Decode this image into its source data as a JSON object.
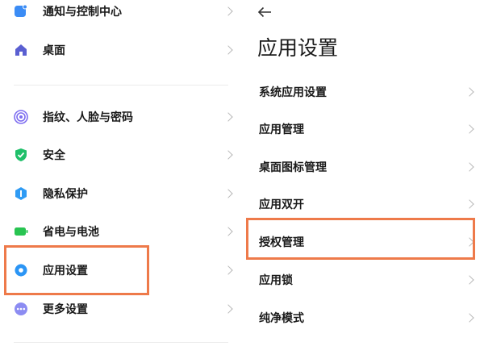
{
  "left_list": {
    "top_group": [
      {
        "label": "通知与控制中心",
        "icon": "notification-icon",
        "color": "#3b8cf5"
      },
      {
        "label": "桌面",
        "icon": "home-icon",
        "color": "#5a5fd1"
      }
    ],
    "bottom_group": [
      {
        "label": "指纹、人脸与密码",
        "icon": "fingerprint-icon",
        "color": "#7d6df0"
      },
      {
        "label": "安全",
        "icon": "shield-icon",
        "color": "#1fbf6a"
      },
      {
        "label": "隐私保护",
        "icon": "privacy-icon",
        "color": "#2f9bf4"
      },
      {
        "label": "省电与电池",
        "icon": "battery-icon",
        "color": "#28c451"
      },
      {
        "label": "应用设置",
        "icon": "gear-icon",
        "color": "#2b95f5",
        "highlighted": true
      },
      {
        "label": "更多设置",
        "icon": "more-icon",
        "color": "#8c8cf2"
      }
    ]
  },
  "right_panel": {
    "back_icon": "back-arrow-icon",
    "title": "应用设置",
    "items": [
      {
        "label": "系统应用设置"
      },
      {
        "label": "应用管理"
      },
      {
        "label": "桌面图标管理"
      },
      {
        "label": "应用双开"
      },
      {
        "label": "授权管理",
        "highlighted": true
      },
      {
        "label": "应用锁"
      },
      {
        "label": "纯净模式"
      }
    ]
  },
  "colors": {
    "highlight": "#ee7a4a",
    "chevron": "#b8b8b8",
    "divider": "#ececec"
  }
}
